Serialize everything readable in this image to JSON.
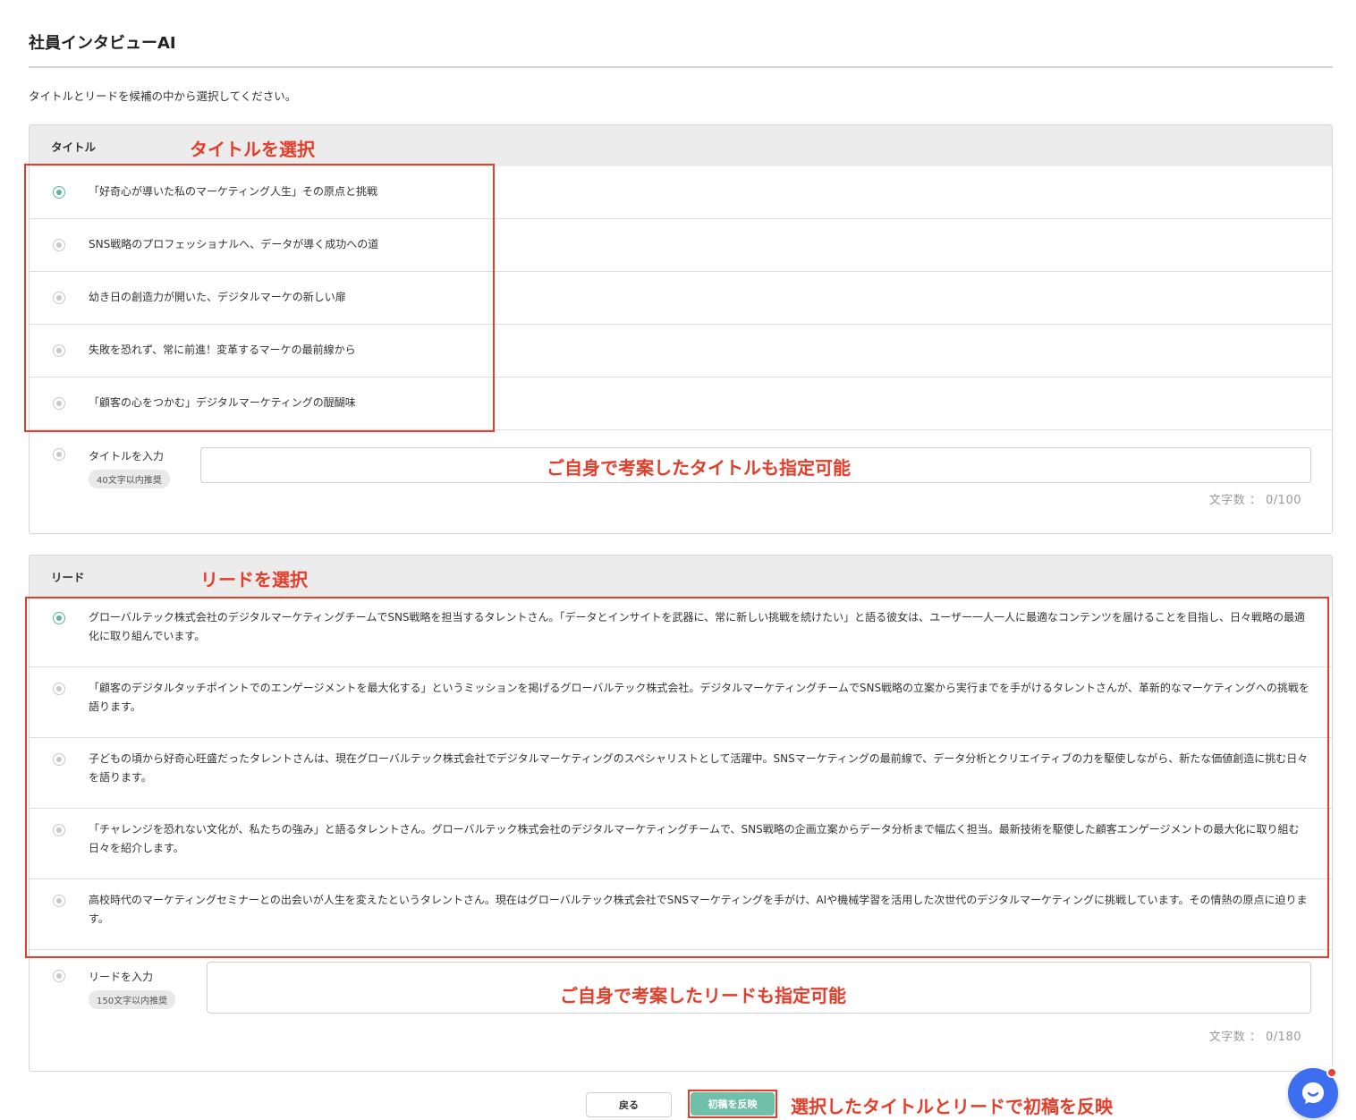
{
  "app": {
    "title": "社員インタビューAI"
  },
  "instruction": "タイトルとリードを候補の中から選択してください。",
  "title_section": {
    "header": "タイトル",
    "selected_index": 0,
    "options": [
      "「好奇心が導いた私のマーケティング人生」その原点と挑戦",
      "SNS戦略のプロフェッショナルへ、データが導く成功への道",
      "幼き日の創造力が開いた、デジタルマーケの新しい扉",
      "失敗を恐れず、常に前進！変革するマーケの最前線から",
      "「顧客の心をつかむ」デジタルマーケティングの醍醐味"
    ],
    "custom_label": "タイトルを入力",
    "custom_badge": "40文字以内推奨",
    "custom_value": "",
    "char_count": "文字数 ： 0/100"
  },
  "lead_section": {
    "header": "リード",
    "selected_index": 0,
    "options": [
      "グローバルテック株式会社のデジタルマーケティングチームでSNS戦略を担当するタレントさん。「データとインサイトを武器に、常に新しい挑戦を続けたい」と語る彼女は、ユーザー一人一人に最適なコンテンツを届けることを目指し、日々戦略の最適化に取り組んでいます。",
      "「顧客のデジタルタッチポイントでのエンゲージメントを最大化する」というミッションを掲げるグローバルテック株式会社。デジタルマーケティングチームでSNS戦略の立案から実行までを手がけるタレントさんが、革新的なマーケティングへの挑戦を語ります。",
      "子どもの頃から好奇心旺盛だったタレントさんは、現在グローバルテック株式会社でデジタルマーケティングのスペシャリストとして活躍中。SNSマーケティングの最前線で、データ分析とクリエイティブの力を駆使しながら、新たな価値創造に挑む日々を語ります。",
      "「チャレンジを恐れない文化が、私たちの強み」と語るタレントさん。グローバルテック株式会社のデジタルマーケティングチームで、SNS戦略の企画立案からデータ分析まで幅広く担当。最新技術を駆使した顧客エンゲージメントの最大化に取り組む日々を紹介します。",
      "高校時代のマーケティングセミナーとの出会いが人生を変えたというタレントさん。現在はグローバルテック株式会社でSNSマーケティングを手がけ、AIや機械学習を活用した次世代のデジタルマーケティングに挑戦しています。その情熱の原点に迫ります。"
    ],
    "custom_label": "リードを入力",
    "custom_badge": "150文字以内推奨",
    "custom_value": "",
    "char_count": "文字数 ： 0/180"
  },
  "buttons": {
    "back": "戻る",
    "apply": "初稿を反映"
  },
  "annotations": {
    "select_title": "タイトルを選択",
    "custom_title": "ご自身で考案したタイトルも指定可能",
    "select_lead": "リードを選択",
    "custom_lead": "ご自身で考案したリードも指定可能",
    "apply_note": "選択したタイトルとリードで初稿を反映"
  },
  "colors": {
    "accent": "#5fb3a3",
    "annotation": "#e43d2a",
    "chat": "#3d6ef0"
  },
  "icons": {
    "chat_widget": "chat-bubble-icon"
  }
}
